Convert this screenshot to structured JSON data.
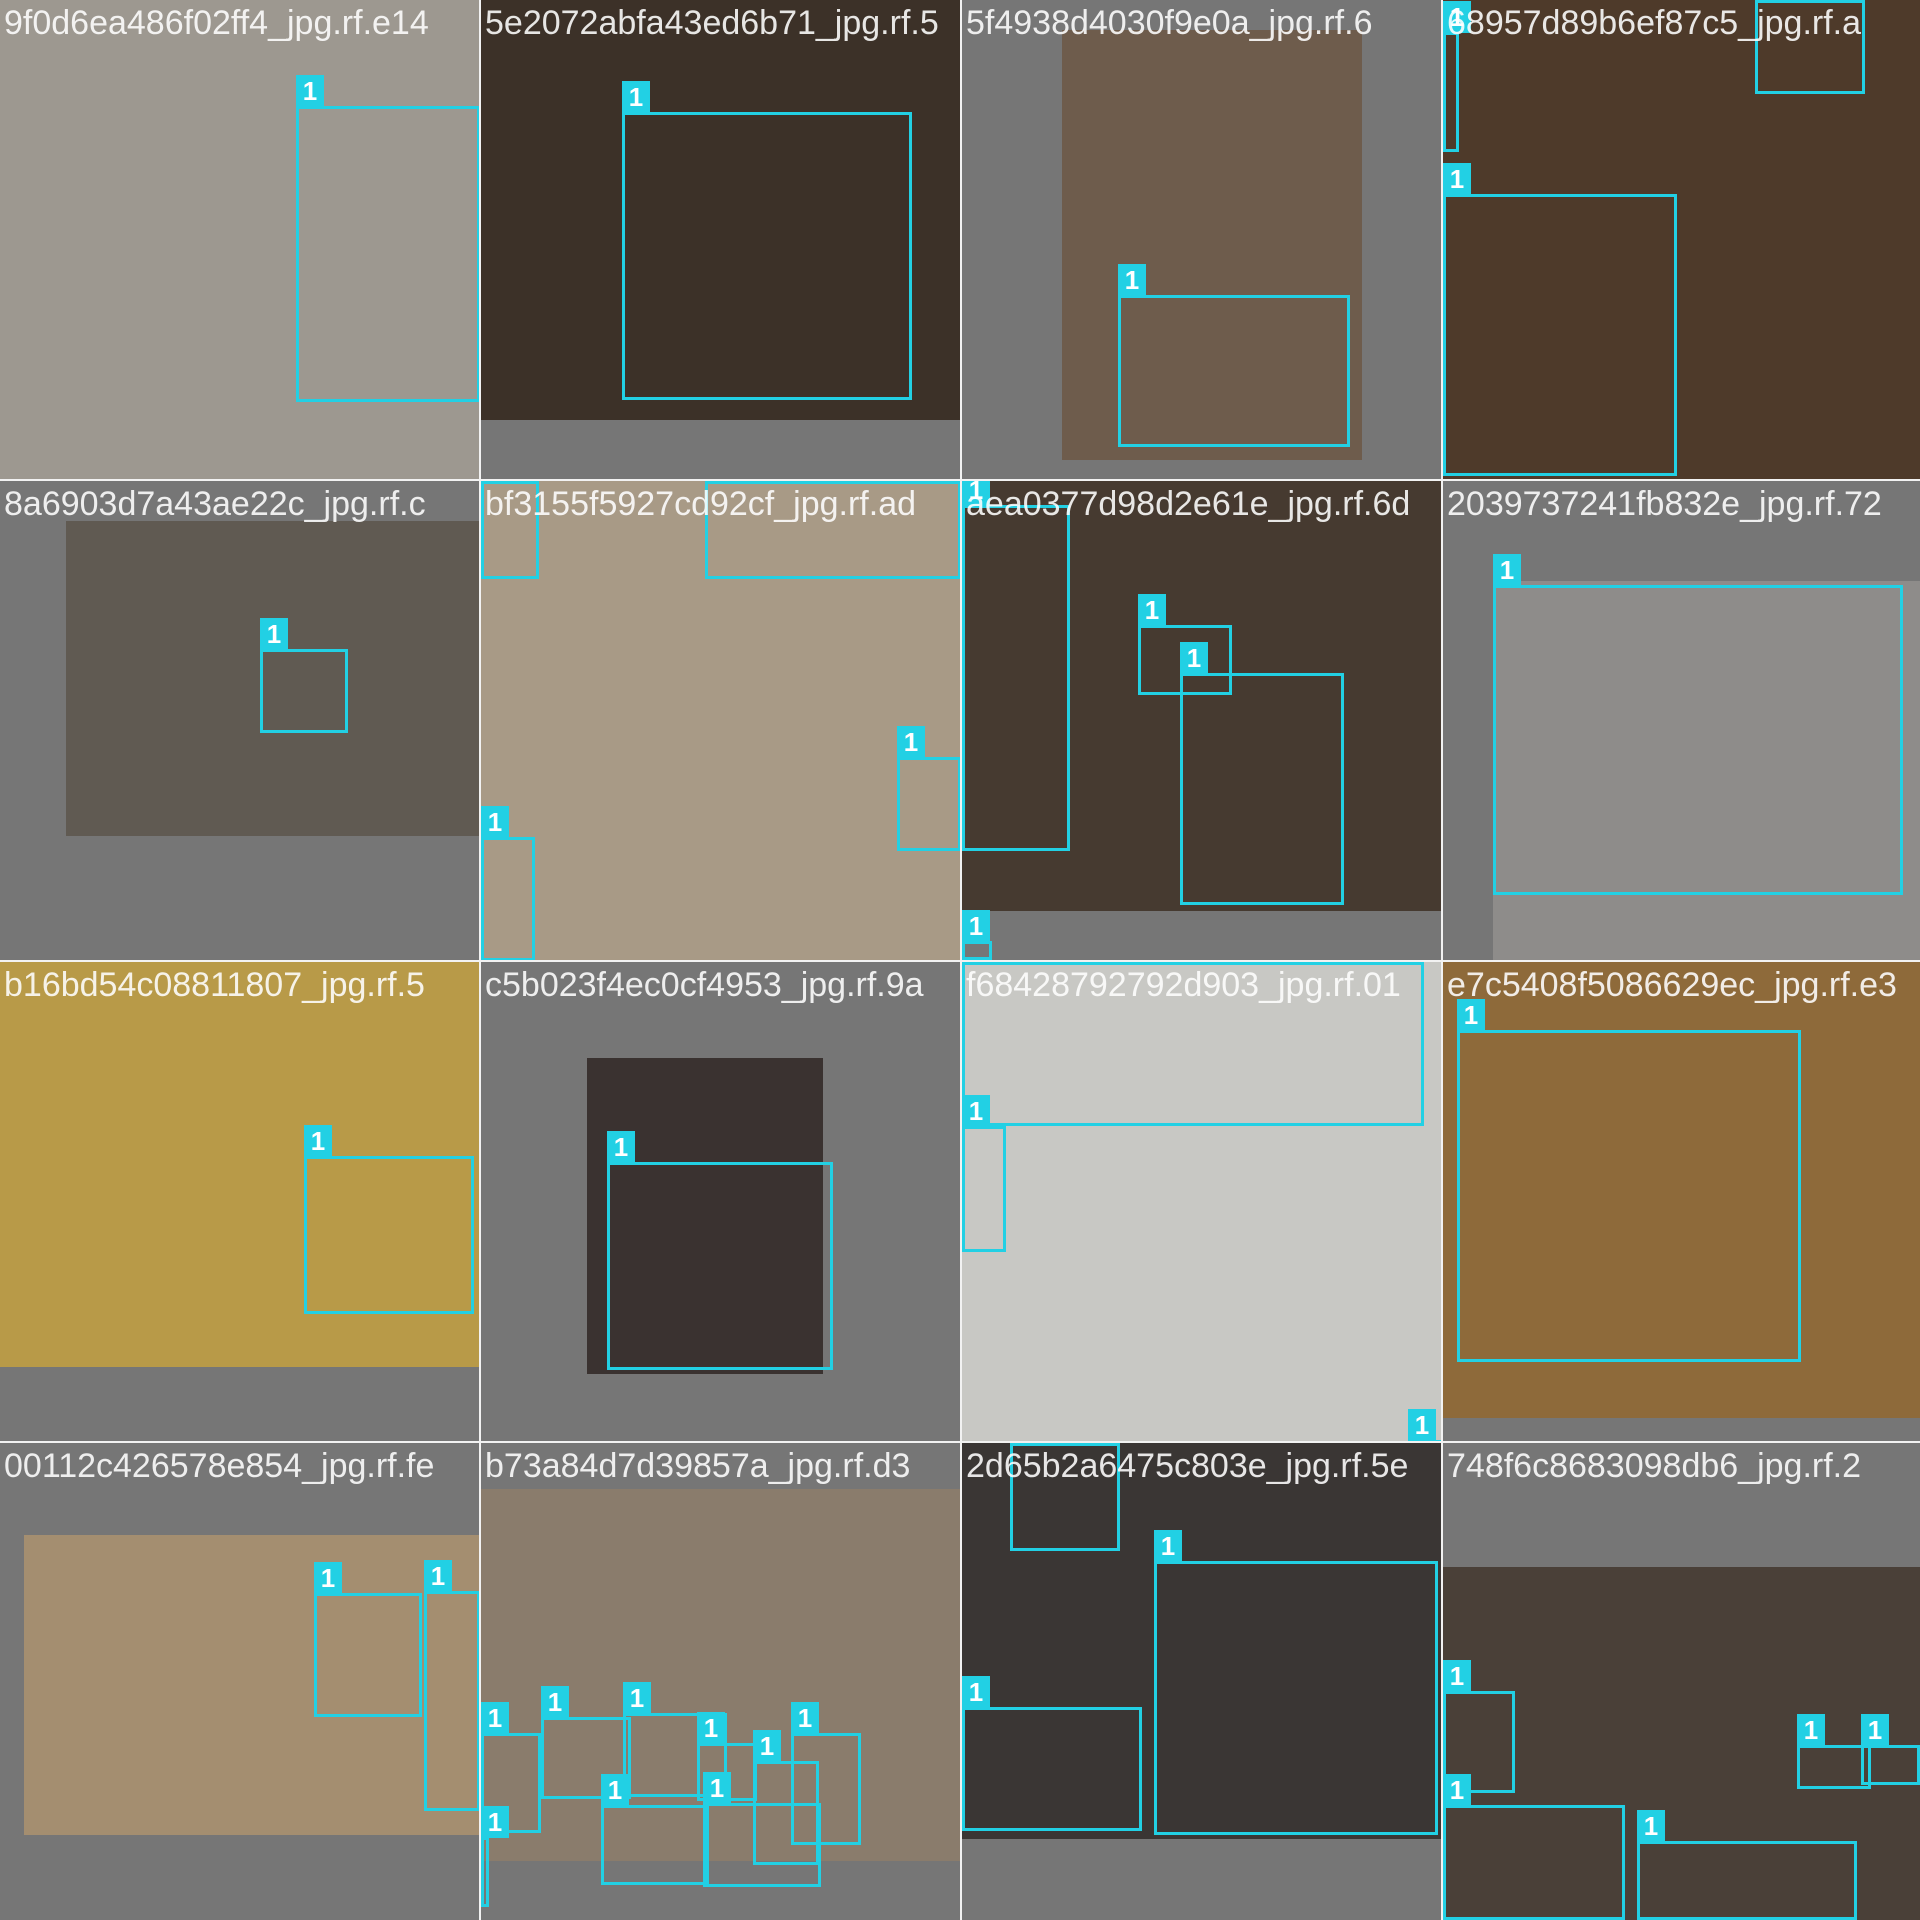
{
  "colors": {
    "box": "#22d0e4",
    "label_text": "#ffffff",
    "background": "#777777"
  },
  "tiles": [
    {
      "label": "9f0d6ea486f02ff4_jpg.rf.e14",
      "photo": "#9d9890",
      "boxes": [
        {
          "tag": "1"
        }
      ]
    },
    {
      "label": "5e2072abfa43ed6b71_jpg.rf.5",
      "photo": "#3c3128",
      "boxes": [
        {
          "tag": "1"
        }
      ]
    },
    {
      "label": "5f4938d4030f9e0a_jpg.rf.6",
      "photo": "#6e5c4c",
      "boxes": [
        {
          "tag": "1"
        }
      ]
    },
    {
      "label": "68957d89b6ef87c5_jpg.rf.a",
      "photo": "#4e3a2a",
      "boxes": [
        {
          "tag": "1"
        },
        {
          "tag": "1"
        },
        {
          "tag": "1"
        }
      ]
    },
    {
      "label": "8a6903d7a43ae22c_jpg.rf.c",
      "photo": "#605a52",
      "boxes": [
        {
          "tag": "1"
        }
      ]
    },
    {
      "label": "bf3155f5927cd92cf_jpg.rf.ad",
      "photo": "#a89a86",
      "boxes": [
        {
          "tag": "1"
        },
        {
          "tag": "1"
        },
        {
          "tag": "1"
        },
        {
          "tag": "1"
        }
      ]
    },
    {
      "label": "aea0377d98d2e61e_jpg.rf.6d",
      "photo": "#463a30",
      "boxes": [
        {
          "tag": "1"
        },
        {
          "tag": "1"
        },
        {
          "tag": "1"
        },
        {
          "tag": "1"
        }
      ]
    },
    {
      "label": "2039737241fb832e_jpg.rf.72",
      "photo": "#8e8c8a",
      "boxes": [
        {
          "tag": "1"
        }
      ]
    },
    {
      "label": "b16bd54c08811807_jpg.rf.5",
      "photo": "#b89a48",
      "boxes": [
        {
          "tag": "1"
        }
      ]
    },
    {
      "label": "c5b023f4ec0cf4953_jpg.rf.9a",
      "photo": "#3a3230",
      "boxes": [
        {
          "tag": "1"
        }
      ]
    },
    {
      "label": "f68428792792d903_jpg.rf.01",
      "photo": "#c8c8c4",
      "boxes": [
        {
          "tag": "1"
        },
        {
          "tag": "1"
        },
        {
          "tag": "1"
        }
      ]
    },
    {
      "label": "e7c5408f5086629ec_jpg.rf.e3",
      "photo": "#8e6a3a",
      "boxes": [
        {
          "tag": "1"
        }
      ]
    },
    {
      "label": "00112c426578e854_jpg.rf.fe",
      "photo": "#a48e70",
      "boxes": [
        {
          "tag": "1"
        },
        {
          "tag": "1"
        }
      ]
    },
    {
      "label": "b73a84d7d39857a_jpg.rf.d3",
      "photo": "#8a7c6c",
      "boxes": [
        {
          "tag": "1"
        },
        {
          "tag": "1"
        },
        {
          "tag": "1"
        },
        {
          "tag": "1"
        },
        {
          "tag": "1"
        },
        {
          "tag": "1"
        },
        {
          "tag": "1"
        },
        {
          "tag": "1"
        },
        {
          "tag": "1"
        }
      ]
    },
    {
      "label": "2d65b2a6475c803e_jpg.rf.5e",
      "photo": "#3a3634",
      "boxes": [
        {
          "tag": "1"
        },
        {
          "tag": "1"
        },
        {
          "tag": "1"
        }
      ]
    },
    {
      "label": "748f6c8683098db6_jpg.rf.2",
      "photo": "#4a4038",
      "boxes": [
        {
          "tag": "1"
        },
        {
          "tag": "1"
        },
        {
          "tag": "1"
        },
        {
          "tag": "1"
        },
        {
          "tag": "1"
        }
      ]
    }
  ]
}
